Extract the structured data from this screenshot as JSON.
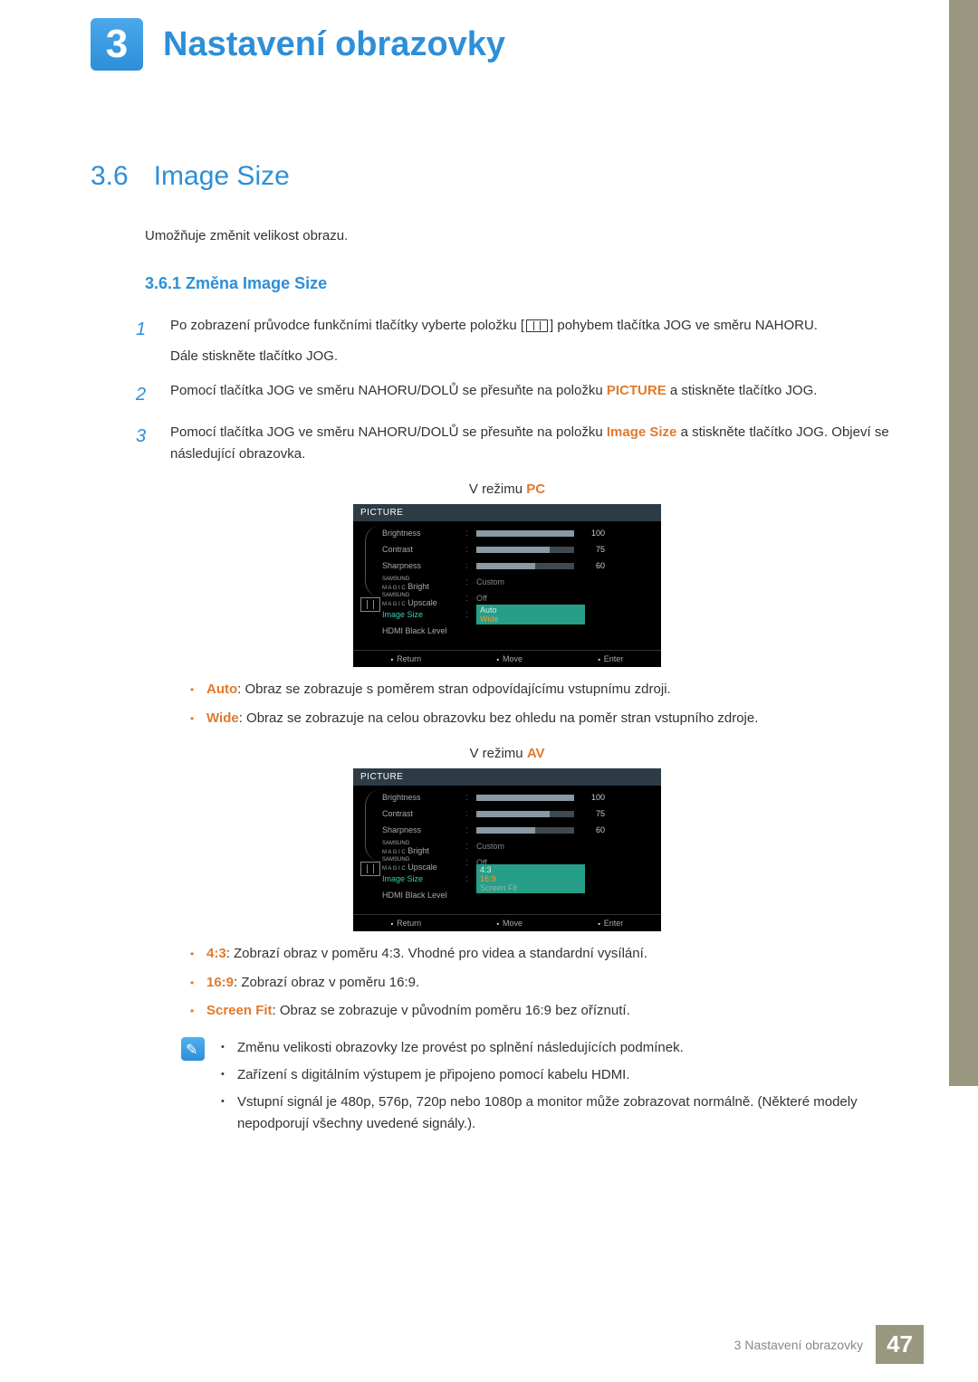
{
  "chapter": {
    "number": "3",
    "title": "Nastavení obrazovky"
  },
  "section": {
    "number": "3.6",
    "title": "Image Size",
    "intro": "Umožňuje změnit velikost obrazu."
  },
  "subsection": {
    "number_title": "3.6.1  Změna Image Size"
  },
  "steps": {
    "s1a": "Po zobrazení průvodce funkčními tlačítky vyberte položku [",
    "s1b": "] pohybem tlačítka JOG ve směru NAHORU.",
    "s1c": "Dále stiskněte tlačítko JOG.",
    "s2a": "Pomocí tlačítka JOG ve směru NAHORU/DOLŮ se přesuňte na položku ",
    "s2b": " a stiskněte tlačítko JOG.",
    "s3a": "Pomocí tlačítka JOG ve směru NAHORU/DOLŮ se přesuňte na položku ",
    "s3b": " a stiskněte tlačítko JOG. Objeví se následující obrazovka.",
    "picture_word": "PICTURE",
    "imgsize_word": "Image Size"
  },
  "mode_pc_prefix": "V režimu ",
  "mode_pc_word": "PC",
  "mode_av_prefix": "V režimu ",
  "mode_av_word": "AV",
  "osd": {
    "title": "PICTURE",
    "brightness": "Brightness",
    "brightness_val": "100",
    "contrast": "Contrast",
    "contrast_val": "75",
    "sharpness": "Sharpness",
    "sharpness_val": "60",
    "magic_bright": "Bright",
    "magic_bright_val": "Custom",
    "magic_upscale": "Upscale",
    "magic_upscale_val": "Off",
    "image_size": "Image Size",
    "hdmi_black": "HDMI Black Level",
    "magic_logo1": "SAMSUNG",
    "magic_logo2": "M A G I C",
    "pc_options": {
      "auto": "Auto",
      "wide": "Wide"
    },
    "av_options": {
      "o43": "4:3",
      "o169": "16:9",
      "ofit": "Screen Fit"
    },
    "footer": {
      "return": "Return",
      "move": "Move",
      "enter": "Enter"
    }
  },
  "bullets_pc": {
    "auto_label": "Auto",
    "auto_text": ": Obraz se zobrazuje s poměrem stran odpovídajícímu vstupnímu zdroji.",
    "wide_label": "Wide",
    "wide_text": ": Obraz se zobrazuje na celou obrazovku bez ohledu na poměr stran vstupního zdroje."
  },
  "bullets_av": {
    "l43": "4:3",
    "t43": ": Zobrazí obraz v poměru 4:3. Vhodné pro videa a standardní vysílání.",
    "l169": "16:9",
    "t169": ": Zobrazí obraz v poměru 16:9.",
    "lfit": "Screen Fit",
    "tfit": ": Obraz se zobrazuje v původním poměru 16:9 bez oříznutí."
  },
  "note": {
    "n1": "Změnu velikosti obrazovky lze provést po splnění následujících podmínek.",
    "n2": "Zařízení s digitálním výstupem je připojeno pomocí kabelu HDMI.",
    "n3": "Vstupní signál je 480p, 576p, 720p nebo 1080p a monitor může zobrazovat normálně. (Některé modely nepodporují všechny uvedené signály.)."
  },
  "footer": {
    "text": "3 Nastavení obrazovky",
    "page": "47"
  }
}
